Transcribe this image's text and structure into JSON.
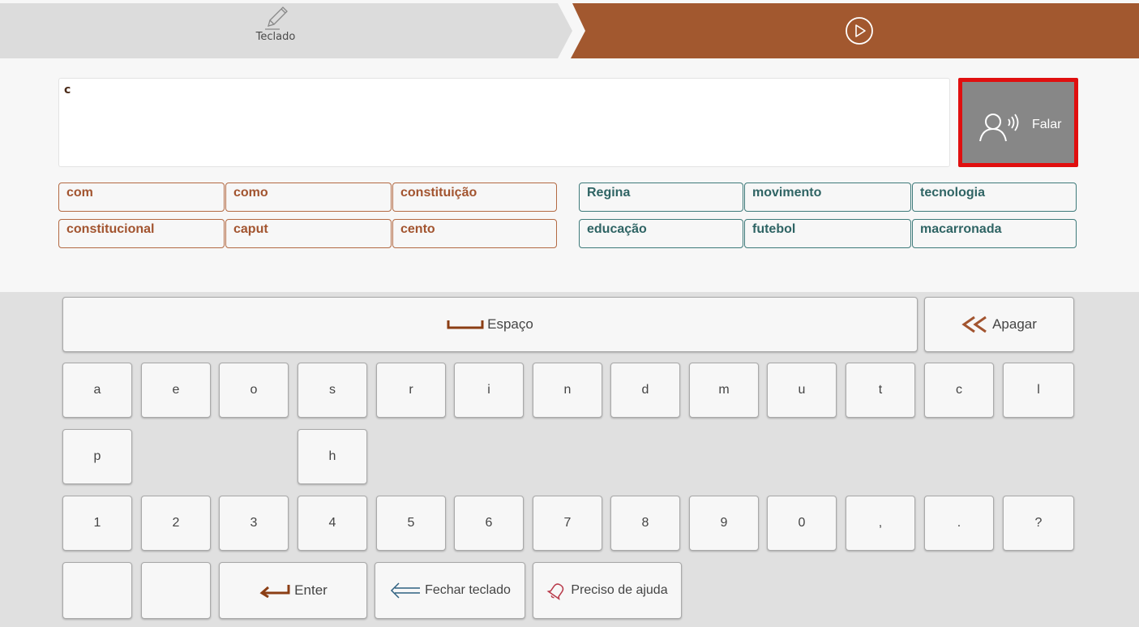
{
  "header": {
    "tab_label": "Teclado",
    "tab_icon": "pencil-icon",
    "play_icon": "play-circle-icon",
    "accent_color": "#a2582f"
  },
  "text_area": {
    "value": "c"
  },
  "speak_button": {
    "label": "Falar",
    "icon": "speaking-person-icon"
  },
  "suggestions": {
    "left": [
      "com",
      "como",
      "constituição",
      "constitucional",
      "caput",
      "cento"
    ],
    "right": [
      "Regina",
      "movimento",
      "tecnologia",
      "educação",
      "futebol",
      "macarronada"
    ]
  },
  "keyboard": {
    "space_label": "Espaço",
    "backspace_label": "Apagar",
    "letter_row_1": [
      "a",
      "e",
      "o",
      "s",
      "r",
      "i",
      "n",
      "d",
      "m",
      "u",
      "t",
      "c",
      "l"
    ],
    "letter_row_2": [
      "p",
      "h"
    ],
    "number_row": [
      "1",
      "2",
      "3",
      "4",
      "5",
      "6",
      "7",
      "8",
      "9",
      "0",
      ",",
      ".",
      "?"
    ],
    "enter_label": "Enter",
    "close_label": "Fechar teclado",
    "help_label": "Preciso de ajuda"
  }
}
